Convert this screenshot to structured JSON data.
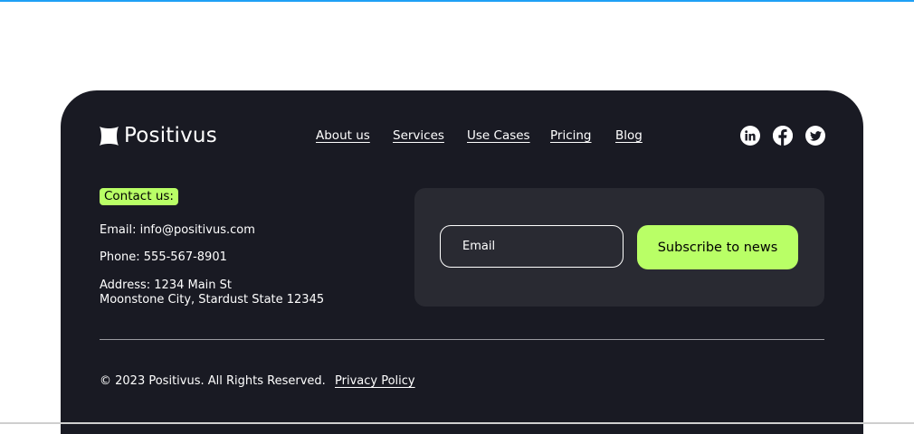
{
  "brand": {
    "name": "Positivus",
    "icon": "star-logo-icon"
  },
  "nav": {
    "items": [
      {
        "label": "About us"
      },
      {
        "label": "Services"
      },
      {
        "label": "Use Cases"
      },
      {
        "label": "Pricing"
      },
      {
        "label": "Blog"
      }
    ]
  },
  "social": [
    {
      "icon": "linkedin-icon"
    },
    {
      "icon": "facebook-icon"
    },
    {
      "icon": "twitter-icon"
    }
  ],
  "contact": {
    "badge": "Contact us:",
    "email": "Email: info@positivus.com",
    "phone": "Phone: 555-567-8901",
    "address_line1": "Address: 1234 Main St",
    "address_line2": "Moonstone City, Stardust State 12345"
  },
  "subscribe": {
    "email_placeholder": "Email",
    "email_value": "",
    "button_label": "Subscribe to news"
  },
  "legal": {
    "copyright": "© 2023 Positivus. All Rights Reserved.",
    "privacy_label": "Privacy Policy"
  },
  "colors": {
    "background": "#191a23",
    "accent": "#b9ff66",
    "panel": "#292a32",
    "text": "#ffffff"
  }
}
